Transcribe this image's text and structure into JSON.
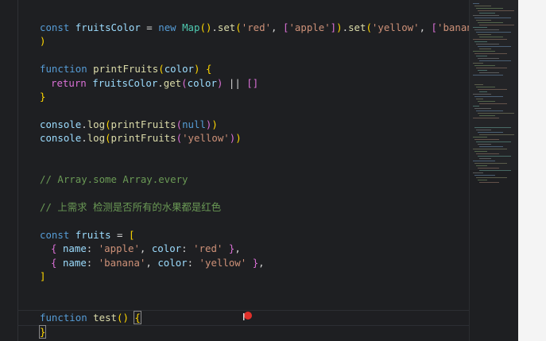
{
  "editor": {
    "lines": [
      {
        "tokens": [
          {
            "c": "kw",
            "t": "const"
          },
          {
            "c": "plain",
            "t": " "
          },
          {
            "c": "var",
            "t": "fruitsColor"
          },
          {
            "c": "plain",
            "t": " = "
          },
          {
            "c": "kw",
            "t": "new"
          },
          {
            "c": "plain",
            "t": " "
          },
          {
            "c": "cls",
            "t": "Map"
          },
          {
            "c": "br1",
            "t": "()"
          },
          {
            "c": "plain",
            "t": "."
          },
          {
            "c": "fn",
            "t": "set"
          },
          {
            "c": "br1",
            "t": "("
          },
          {
            "c": "str",
            "t": "'red'"
          },
          {
            "c": "plain",
            "t": ", "
          },
          {
            "c": "br2",
            "t": "["
          },
          {
            "c": "str",
            "t": "'apple'"
          },
          {
            "c": "br2",
            "t": "]"
          },
          {
            "c": "br1",
            "t": ")"
          },
          {
            "c": "plain",
            "t": "."
          },
          {
            "c": "fn",
            "t": "set"
          },
          {
            "c": "br1",
            "t": "("
          },
          {
            "c": "str",
            "t": "'yellow'"
          },
          {
            "c": "plain",
            "t": ", "
          },
          {
            "c": "br2",
            "t": "["
          },
          {
            "c": "str",
            "t": "'banana'"
          },
          {
            "c": "br2",
            "t": "]"
          }
        ]
      },
      {
        "tokens": [
          {
            "c": "br1",
            "t": ")"
          }
        ]
      },
      {
        "tokens": []
      },
      {
        "tokens": [
          {
            "c": "kw",
            "t": "function"
          },
          {
            "c": "plain",
            "t": " "
          },
          {
            "c": "fn",
            "t": "printFruits"
          },
          {
            "c": "br1",
            "t": "("
          },
          {
            "c": "var",
            "t": "color"
          },
          {
            "c": "br1",
            "t": ")"
          },
          {
            "c": "plain",
            "t": " "
          },
          {
            "c": "br1",
            "t": "{"
          }
        ]
      },
      {
        "indent": 1,
        "tokens": [
          {
            "c": "br2",
            "t": "return"
          },
          {
            "c": "plain",
            "t": " "
          },
          {
            "c": "var",
            "t": "fruitsColor"
          },
          {
            "c": "plain",
            "t": "."
          },
          {
            "c": "fn",
            "t": "get"
          },
          {
            "c": "br2",
            "t": "("
          },
          {
            "c": "var",
            "t": "color"
          },
          {
            "c": "br2",
            "t": ")"
          },
          {
            "c": "plain",
            "t": " || "
          },
          {
            "c": "br2",
            "t": "[]"
          }
        ]
      },
      {
        "tokens": [
          {
            "c": "br1",
            "t": "}"
          }
        ]
      },
      {
        "tokens": []
      },
      {
        "tokens": [
          {
            "c": "var",
            "t": "console"
          },
          {
            "c": "plain",
            "t": "."
          },
          {
            "c": "fn",
            "t": "log"
          },
          {
            "c": "br1",
            "t": "("
          },
          {
            "c": "fn",
            "t": "printFruits"
          },
          {
            "c": "br2",
            "t": "("
          },
          {
            "c": "kw",
            "t": "null"
          },
          {
            "c": "br2",
            "t": ")"
          },
          {
            "c": "br1",
            "t": ")"
          }
        ]
      },
      {
        "tokens": [
          {
            "c": "var",
            "t": "console"
          },
          {
            "c": "plain",
            "t": "."
          },
          {
            "c": "fn",
            "t": "log"
          },
          {
            "c": "br1",
            "t": "("
          },
          {
            "c": "fn",
            "t": "printFruits"
          },
          {
            "c": "br2",
            "t": "("
          },
          {
            "c": "str",
            "t": "'yellow'"
          },
          {
            "c": "br2",
            "t": ")"
          },
          {
            "c": "br1",
            "t": ")"
          }
        ]
      },
      {
        "tokens": []
      },
      {
        "tokens": []
      },
      {
        "tokens": [
          {
            "c": "cm",
            "t": "// Array.some Array.every"
          }
        ]
      },
      {
        "tokens": []
      },
      {
        "tokens": [
          {
            "c": "cm",
            "t": "// 上需求 检测是否所有的水果都是红色"
          }
        ]
      },
      {
        "tokens": []
      },
      {
        "tokens": [
          {
            "c": "kw",
            "t": "const"
          },
          {
            "c": "plain",
            "t": " "
          },
          {
            "c": "var",
            "t": "fruits"
          },
          {
            "c": "plain",
            "t": " = "
          },
          {
            "c": "br1",
            "t": "["
          }
        ]
      },
      {
        "indent": 1,
        "tokens": [
          {
            "c": "br2",
            "t": "{"
          },
          {
            "c": "plain",
            "t": " "
          },
          {
            "c": "var",
            "t": "name"
          },
          {
            "c": "plain",
            "t": ": "
          },
          {
            "c": "str",
            "t": "'apple'"
          },
          {
            "c": "plain",
            "t": ", "
          },
          {
            "c": "var",
            "t": "color"
          },
          {
            "c": "plain",
            "t": ": "
          },
          {
            "c": "str",
            "t": "'red'"
          },
          {
            "c": "plain",
            "t": " "
          },
          {
            "c": "br2",
            "t": "}"
          },
          {
            "c": "plain",
            "t": ","
          }
        ]
      },
      {
        "indent": 1,
        "tokens": [
          {
            "c": "br2",
            "t": "{"
          },
          {
            "c": "plain",
            "t": " "
          },
          {
            "c": "var",
            "t": "name"
          },
          {
            "c": "plain",
            "t": ": "
          },
          {
            "c": "str",
            "t": "'banana'"
          },
          {
            "c": "plain",
            "t": ", "
          },
          {
            "c": "var",
            "t": "color"
          },
          {
            "c": "plain",
            "t": ": "
          },
          {
            "c": "str",
            "t": "'yellow'"
          },
          {
            "c": "plain",
            "t": " "
          },
          {
            "c": "br2",
            "t": "}"
          },
          {
            "c": "plain",
            "t": ","
          }
        ]
      },
      {
        "tokens": [
          {
            "c": "br1",
            "t": "]"
          }
        ]
      },
      {
        "tokens": []
      },
      {
        "tokens": []
      },
      {
        "current": true,
        "tokens": [
          {
            "c": "kw",
            "t": "function"
          },
          {
            "c": "plain",
            "t": " "
          },
          {
            "c": "fn",
            "t": "test"
          },
          {
            "c": "br1",
            "t": "()"
          },
          {
            "c": "plain",
            "t": " "
          },
          {
            "c": "br1 match",
            "t": "{"
          }
        ]
      },
      {
        "tokens": [
          {
            "c": "br1 match",
            "t": "}"
          }
        ]
      }
    ]
  },
  "minimap": {
    "accent": "#4ec9b0"
  },
  "cursor": {
    "icon": "text-cursor-icon",
    "record_indicator": "record-dot-icon"
  }
}
